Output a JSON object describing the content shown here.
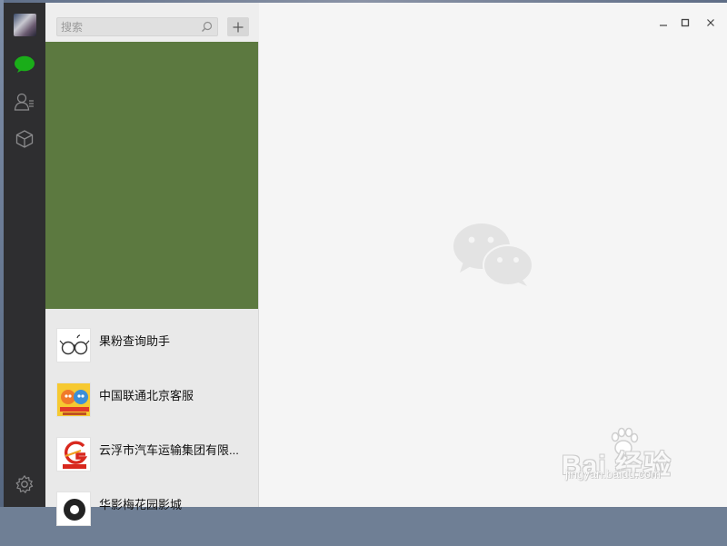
{
  "app": {
    "accent_color": "#1aad19"
  },
  "rail": {
    "items": [
      {
        "icon": "chat-icon",
        "active": true
      },
      {
        "icon": "contacts-icon",
        "active": false
      },
      {
        "icon": "favorites-cube-icon",
        "active": false
      },
      {
        "icon": "settings-gear-icon",
        "active": false
      }
    ]
  },
  "search": {
    "placeholder": "搜索",
    "value": ""
  },
  "add_button": {
    "icon": "plus-icon"
  },
  "banner": {
    "color": "#5c7940"
  },
  "chats": [
    {
      "name": "果粉查询助手",
      "thumb": "glasses-logo"
    },
    {
      "name": "中国联通北京客服",
      "thumb": "unicom-mascot-logo"
    },
    {
      "name": "云浮市汽车运输集团有限...",
      "thumb": "yunfu-transport-logo"
    },
    {
      "name": "华影梅花园影城",
      "thumb": "cinema-logo"
    }
  ],
  "window_controls": {
    "minimize": "–",
    "maximize": "□",
    "close": "×"
  },
  "watermark": {
    "main": "Bai 经验",
    "sub": "jingyan.baidu.com"
  }
}
